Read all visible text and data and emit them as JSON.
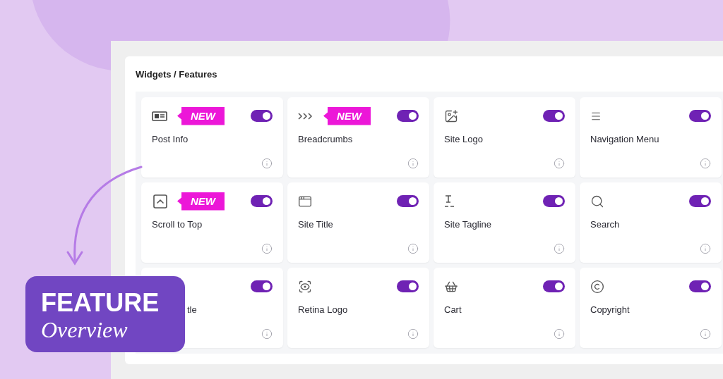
{
  "panel_title": "Widgets / Features",
  "widgets": [
    {
      "label": "Post Info",
      "badge": "NEW",
      "on": true
    },
    {
      "label": "Breadcrumbs",
      "badge": "NEW",
      "on": true
    },
    {
      "label": "Site Logo",
      "on": true
    },
    {
      "label": "Navigation Menu",
      "on": true
    },
    {
      "label": "Scroll to Top",
      "badge": "NEW",
      "on": true
    },
    {
      "label": "Site Title",
      "on": true
    },
    {
      "label": "Site Tagline",
      "on": true
    },
    {
      "label": "Search",
      "on": true
    },
    {
      "label": "tle",
      "on": true,
      "partly_hidden": true
    },
    {
      "label": "Retina Logo",
      "on": true
    },
    {
      "label": "Cart",
      "on": true
    },
    {
      "label": "Copyright",
      "on": true
    }
  ],
  "overlay": {
    "title": "FEATURE",
    "subtitle": "Overview"
  }
}
